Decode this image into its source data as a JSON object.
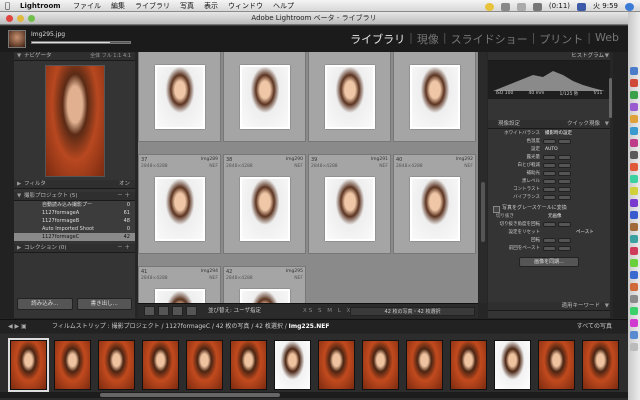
{
  "menubar": {
    "app": "Lightroom",
    "menus": [
      "ファイル",
      "編集",
      "ライブラリ",
      "写真",
      "表示",
      "ウィンドウ",
      "ヘルプ"
    ],
    "battery": "(0:11)",
    "clock": "火 9:59"
  },
  "window": {
    "title": "Adobe Lightroom ベータ - ライブラリ"
  },
  "header": {
    "catalog": "Img295.jpg",
    "progress": 0.8,
    "modules": [
      "ライブラリ",
      "現像",
      "スライドショー",
      "プリント",
      "Web"
    ]
  },
  "navigator": {
    "title": "ナビゲータ",
    "zoom": "全体 フル 1:1 4:1"
  },
  "filter": {
    "title": "フィルタ",
    "toggle": "オン"
  },
  "collections": {
    "title": "撮影プロジェクト (5)",
    "items": [
      {
        "label": "自動読み込み撮影プー",
        "count": "0"
      },
      {
        "label": "1127formageA",
        "count": "61"
      },
      {
        "label": "1127formageB",
        "count": "48"
      },
      {
        "label": "Auto Imported Shoot",
        "count": "0"
      },
      {
        "label": "1127formageC",
        "count": "42"
      }
    ],
    "selected_index": 4,
    "collection_title": "コレクション (0)"
  },
  "left_buttons": {
    "import": "読み込み...",
    "export": "書き出し..."
  },
  "grid": {
    "cells": [
      {
        "num": "37",
        "name": "Img289",
        "dim": "2848×4288",
        "ext": "NEF"
      },
      {
        "num": "38",
        "name": "Img290",
        "dim": "2848×4288",
        "ext": "NEF"
      },
      {
        "num": "39",
        "name": "Img291",
        "dim": "2848×4288",
        "ext": "NEF"
      },
      {
        "num": "40",
        "name": "Img292",
        "dim": "2848×4288",
        "ext": "NEF"
      },
      {
        "num": "41",
        "name": "Img294",
        "dim": "2848×4288",
        "ext": "NEF"
      },
      {
        "num": "42",
        "name": "Img295",
        "dim": "2848×4288",
        "ext": "NEF"
      }
    ]
  },
  "grid_toolbar": {
    "sort_label": "並び替え: ユーザ指定",
    "sizes": "XS S M L XL",
    "count_label": "42 枚の写真・42 枚選択"
  },
  "histogram": {
    "title": "ヒストグラム",
    "iso": "ISO 100",
    "focal": "40 mm",
    "shutter": "1/125 秒",
    "aperture": "f/11"
  },
  "quick_develop": {
    "title": "現像設定",
    "preset": "クイック現像",
    "rows": [
      {
        "label": "ホワイトバランス",
        "value": "撮影時の設定"
      },
      {
        "label": "色温度"
      },
      {
        "label": "設定",
        "value": "AUTO"
      },
      {
        "label": "露光量"
      },
      {
        "label": "白とび軽減"
      },
      {
        "label": "補助光"
      },
      {
        "label": "黒レベル"
      },
      {
        "label": "コントラスト"
      },
      {
        "label": "バイブランス"
      }
    ],
    "grayscale": "写真をグレースケールに変換",
    "detail_title": "切り抜き",
    "detail_value": "元画像",
    "detail_rows": [
      {
        "label": "切り抜き角度を回転"
      },
      {
        "label": "設定をリセット",
        "value": "ペースト"
      },
      {
        "label": "回転"
      },
      {
        "label": "前回をペースト"
      }
    ],
    "sync_button": "画像を同期..."
  },
  "keywords": {
    "title": "適用キーワード"
  },
  "filmstrip": {
    "breadcrumb_prefix": "フィルムストリップ : 撮影プロジェクト / 1127formageC / 42 枚の写真 / 42 枚選択 / ",
    "breadcrumb_current": "Img225.NEF",
    "filter": "すべての写真",
    "thumbs": 14,
    "selected_index": 0
  }
}
